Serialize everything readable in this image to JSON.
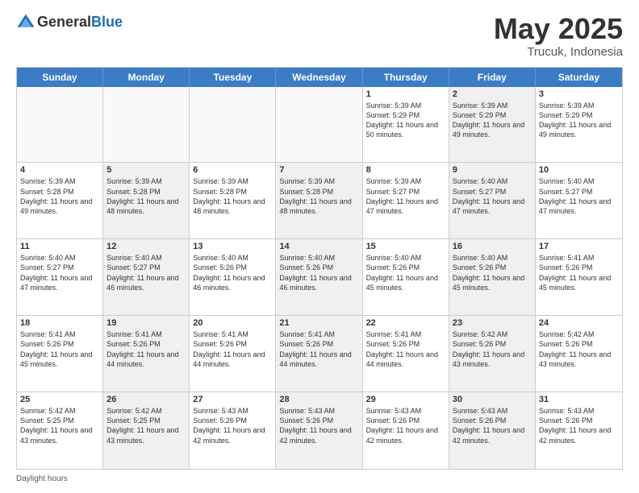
{
  "header": {
    "logo_general": "General",
    "logo_blue": "Blue",
    "month_title": "May 2025",
    "location": "Trucuk, Indonesia"
  },
  "days_of_week": [
    "Sunday",
    "Monday",
    "Tuesday",
    "Wednesday",
    "Thursday",
    "Friday",
    "Saturday"
  ],
  "footer_label": "Daylight hours",
  "weeks": [
    [
      {
        "day": "",
        "empty": true,
        "shaded": false
      },
      {
        "day": "",
        "empty": true,
        "shaded": false
      },
      {
        "day": "",
        "empty": true,
        "shaded": false
      },
      {
        "day": "",
        "empty": true,
        "shaded": false
      },
      {
        "day": "1",
        "empty": false,
        "shaded": false,
        "sunrise": "5:39 AM",
        "sunset": "5:29 PM",
        "daylight": "11 hours and 50 minutes."
      },
      {
        "day": "2",
        "empty": false,
        "shaded": true,
        "sunrise": "5:39 AM",
        "sunset": "5:29 PM",
        "daylight": "11 hours and 49 minutes."
      },
      {
        "day": "3",
        "empty": false,
        "shaded": false,
        "sunrise": "5:39 AM",
        "sunset": "5:29 PM",
        "daylight": "11 hours and 49 minutes."
      }
    ],
    [
      {
        "day": "4",
        "empty": false,
        "shaded": false,
        "sunrise": "5:39 AM",
        "sunset": "5:28 PM",
        "daylight": "11 hours and 49 minutes."
      },
      {
        "day": "5",
        "empty": false,
        "shaded": true,
        "sunrise": "5:39 AM",
        "sunset": "5:28 PM",
        "daylight": "11 hours and 48 minutes."
      },
      {
        "day": "6",
        "empty": false,
        "shaded": false,
        "sunrise": "5:39 AM",
        "sunset": "5:28 PM",
        "daylight": "11 hours and 48 minutes."
      },
      {
        "day": "7",
        "empty": false,
        "shaded": true,
        "sunrise": "5:39 AM",
        "sunset": "5:28 PM",
        "daylight": "11 hours and 48 minutes."
      },
      {
        "day": "8",
        "empty": false,
        "shaded": false,
        "sunrise": "5:39 AM",
        "sunset": "5:27 PM",
        "daylight": "11 hours and 47 minutes."
      },
      {
        "day": "9",
        "empty": false,
        "shaded": true,
        "sunrise": "5:40 AM",
        "sunset": "5:27 PM",
        "daylight": "11 hours and 47 minutes."
      },
      {
        "day": "10",
        "empty": false,
        "shaded": false,
        "sunrise": "5:40 AM",
        "sunset": "5:27 PM",
        "daylight": "11 hours and 47 minutes."
      }
    ],
    [
      {
        "day": "11",
        "empty": false,
        "shaded": false,
        "sunrise": "5:40 AM",
        "sunset": "5:27 PM",
        "daylight": "11 hours and 47 minutes."
      },
      {
        "day": "12",
        "empty": false,
        "shaded": true,
        "sunrise": "5:40 AM",
        "sunset": "5:27 PM",
        "daylight": "11 hours and 46 minutes."
      },
      {
        "day": "13",
        "empty": false,
        "shaded": false,
        "sunrise": "5:40 AM",
        "sunset": "5:26 PM",
        "daylight": "11 hours and 46 minutes."
      },
      {
        "day": "14",
        "empty": false,
        "shaded": true,
        "sunrise": "5:40 AM",
        "sunset": "5:26 PM",
        "daylight": "11 hours and 46 minutes."
      },
      {
        "day": "15",
        "empty": false,
        "shaded": false,
        "sunrise": "5:40 AM",
        "sunset": "5:26 PM",
        "daylight": "11 hours and 45 minutes."
      },
      {
        "day": "16",
        "empty": false,
        "shaded": true,
        "sunrise": "5:40 AM",
        "sunset": "5:26 PM",
        "daylight": "11 hours and 45 minutes."
      },
      {
        "day": "17",
        "empty": false,
        "shaded": false,
        "sunrise": "5:41 AM",
        "sunset": "5:26 PM",
        "daylight": "11 hours and 45 minutes."
      }
    ],
    [
      {
        "day": "18",
        "empty": false,
        "shaded": false,
        "sunrise": "5:41 AM",
        "sunset": "5:26 PM",
        "daylight": "11 hours and 45 minutes."
      },
      {
        "day": "19",
        "empty": false,
        "shaded": true,
        "sunrise": "5:41 AM",
        "sunset": "5:26 PM",
        "daylight": "11 hours and 44 minutes."
      },
      {
        "day": "20",
        "empty": false,
        "shaded": false,
        "sunrise": "5:41 AM",
        "sunset": "5:26 PM",
        "daylight": "11 hours and 44 minutes."
      },
      {
        "day": "21",
        "empty": false,
        "shaded": true,
        "sunrise": "5:41 AM",
        "sunset": "5:26 PM",
        "daylight": "11 hours and 44 minutes."
      },
      {
        "day": "22",
        "empty": false,
        "shaded": false,
        "sunrise": "5:41 AM",
        "sunset": "5:26 PM",
        "daylight": "11 hours and 44 minutes."
      },
      {
        "day": "23",
        "empty": false,
        "shaded": true,
        "sunrise": "5:42 AM",
        "sunset": "5:26 PM",
        "daylight": "11 hours and 43 minutes."
      },
      {
        "day": "24",
        "empty": false,
        "shaded": false,
        "sunrise": "5:42 AM",
        "sunset": "5:26 PM",
        "daylight": "11 hours and 43 minutes."
      }
    ],
    [
      {
        "day": "25",
        "empty": false,
        "shaded": false,
        "sunrise": "5:42 AM",
        "sunset": "5:25 PM",
        "daylight": "11 hours and 43 minutes."
      },
      {
        "day": "26",
        "empty": false,
        "shaded": true,
        "sunrise": "5:42 AM",
        "sunset": "5:25 PM",
        "daylight": "11 hours and 43 minutes."
      },
      {
        "day": "27",
        "empty": false,
        "shaded": false,
        "sunrise": "5:43 AM",
        "sunset": "5:26 PM",
        "daylight": "11 hours and 42 minutes."
      },
      {
        "day": "28",
        "empty": false,
        "shaded": true,
        "sunrise": "5:43 AM",
        "sunset": "5:26 PM",
        "daylight": "11 hours and 42 minutes."
      },
      {
        "day": "29",
        "empty": false,
        "shaded": false,
        "sunrise": "5:43 AM",
        "sunset": "5:26 PM",
        "daylight": "11 hours and 42 minutes."
      },
      {
        "day": "30",
        "empty": false,
        "shaded": true,
        "sunrise": "5:43 AM",
        "sunset": "5:26 PM",
        "daylight": "11 hours and 42 minutes."
      },
      {
        "day": "31",
        "empty": false,
        "shaded": false,
        "sunrise": "5:43 AM",
        "sunset": "5:26 PM",
        "daylight": "11 hours and 42 minutes."
      }
    ]
  ]
}
